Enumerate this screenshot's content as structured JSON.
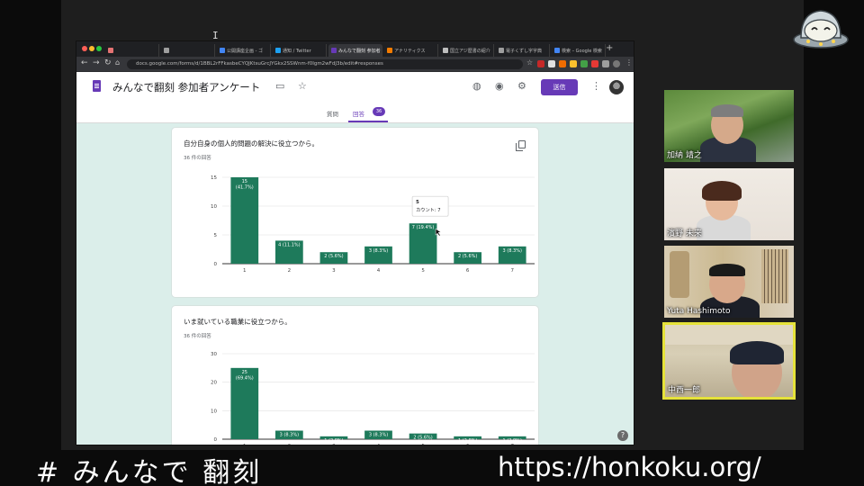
{
  "browser": {
    "tabs": [
      {
        "label": "",
        "active": false,
        "favicon_color": "#e57373"
      },
      {
        "label": "",
        "active": false,
        "favicon_color": "#9e9e9e"
      },
      {
        "label": "公開講座企画 - ゴ",
        "active": false,
        "favicon_color": "#4285f4"
      },
      {
        "label": "通知 / Twitter",
        "active": false,
        "favicon_color": "#1da1f2"
      },
      {
        "label": "みんなで翻刻 参加者",
        "active": true,
        "favicon_color": "#673ab7"
      },
      {
        "label": "アナリティクス",
        "active": false,
        "favicon_color": "#f57c00"
      },
      {
        "label": "国立アジ歴書の紹介",
        "active": false,
        "favicon_color": "#bdbdbd"
      },
      {
        "label": "電子くずし字字典",
        "active": false,
        "favicon_color": "#9e9e9e"
      },
      {
        "label": "検索 – Google 検索",
        "active": false,
        "favicon_color": "#4285f4"
      }
    ],
    "url": "docs.google.com/forms/d/1BBL2rFFkasbeCYQJKtsuGrcJYGkx2SSWnm-f0Igm2wFdJ3b/edit#responses"
  },
  "form": {
    "title": "みんなで翻刻 参加者アンケート",
    "send_label": "送信",
    "tab_questions": "質問",
    "tab_responses": "回答",
    "responses_badge": "36",
    "help": "?"
  },
  "chart_data": [
    {
      "type": "bar",
      "title": "自分自身の個人的問題の解決に役立つから。",
      "subtitle": "36 件の回答",
      "categories": [
        "1",
        "2",
        "3",
        "4",
        "5",
        "6",
        "7"
      ],
      "values": [
        15,
        4,
        2,
        3,
        7,
        2,
        3
      ],
      "data_labels": [
        "15\n(41.7%)",
        "4 (11.1%)",
        "2 (5.6%)",
        "3 (8.3%)",
        "7 (19.4%)",
        "2 (5.6%)",
        "3 (8.3%)"
      ],
      "yticks": [
        0,
        5,
        10,
        15
      ],
      "ylim": [
        0,
        15
      ],
      "grid": true,
      "color": "#1e7a5b",
      "tooltip": {
        "category": "5",
        "text": "カウント: 7"
      }
    },
    {
      "type": "bar",
      "title": "いま就いている職業に役立つから。",
      "subtitle": "36 件の回答",
      "categories": [
        "1",
        "2",
        "3",
        "4",
        "5",
        "6",
        "7"
      ],
      "values": [
        25,
        3,
        1,
        3,
        2,
        1,
        1
      ],
      "data_labels": [
        "25\n(69.4%)",
        "3 (8.3%)",
        "1 (2.8%)",
        "3 (8.3%)",
        "2 (5.6%)",
        "1 (2.8%)",
        "1 (2.8%)"
      ],
      "yticks": [
        0,
        10,
        20,
        30
      ],
      "ylim": [
        0,
        30
      ],
      "grid": true,
      "color": "#1e7a5b"
    }
  ],
  "participants": [
    {
      "name": "加納 靖之"
    },
    {
      "name": "濱野 未来"
    },
    {
      "name": "Yuta Hashimoto"
    },
    {
      "name": "中西一郎",
      "speaking": true
    }
  ],
  "captions": {
    "hashtag": "# みんなで 翻刻",
    "url": "https://honkoku.org/"
  }
}
